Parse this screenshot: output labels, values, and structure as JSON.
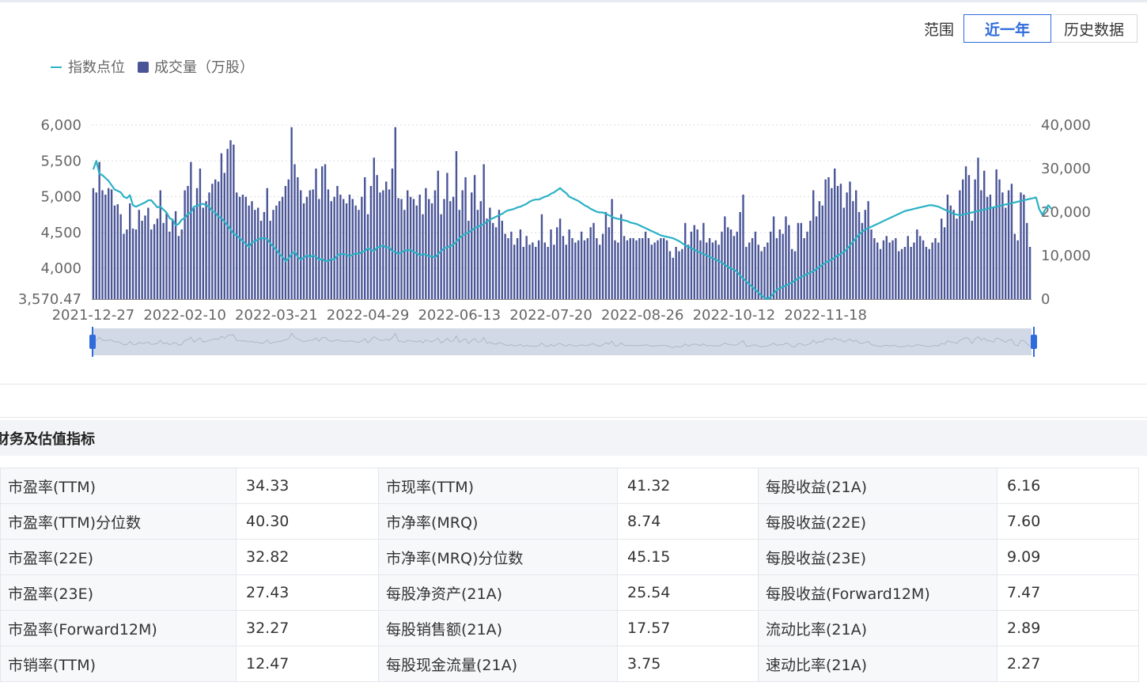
{
  "range": {
    "label": "范围",
    "options": [
      "近一年",
      "历史数据"
    ],
    "selected": "近一年"
  },
  "colors": {
    "line": "#2bb1c5",
    "bar": "#4a5597",
    "accent": "#2f6bdb",
    "grid": "#dddddd"
  },
  "chart_data": {
    "type": "bar",
    "grid": true,
    "legend_position": "top-left",
    "legend": [
      {
        "name": "指数点位",
        "kind": "line"
      },
      {
        "name": "成交量（万股）",
        "kind": "bar"
      }
    ],
    "y_left": {
      "ticks": [
        "6,000",
        "5,500",
        "5,000",
        "4,500",
        "4,000",
        "3,570.47"
      ],
      "range": [
        3570.47,
        6000
      ]
    },
    "y_right": {
      "ticks": [
        "40,000",
        "30,000",
        "20,000",
        "10,000",
        "0"
      ],
      "range": [
        0,
        40000
      ]
    },
    "x_tick_labels": [
      "2021-12-27",
      "2022-02-10",
      "2022-03-21",
      "2022-04-29",
      "2022-06-13",
      "2022-07-20",
      "2022-08-26",
      "2022-10-12",
      "2022-11-18"
    ],
    "x_tick_index": [
      0,
      30,
      60,
      90,
      120,
      150,
      180,
      210,
      240
    ],
    "series": [
      {
        "name": "成交量（万股）",
        "type": "bar",
        "axis": "right",
        "values": [
          25500,
          24500,
          31500,
          25000,
          24000,
          25500,
          25200,
          21500,
          21800,
          19500,
          15000,
          16000,
          22000,
          16200,
          16000,
          20500,
          18000,
          19200,
          21000,
          16000,
          17200,
          18500,
          25000,
          17500,
          19800,
          15500,
          18200,
          20200,
          14500,
          16000,
          25000,
          26000,
          31500,
          21000,
          25500,
          30000,
          21000,
          22500,
          24500,
          26500,
          27500,
          27000,
          33500,
          29000,
          34500,
          36500,
          35500,
          24500,
          23500,
          24000,
          23500,
          21500,
          22500,
          20500,
          21000,
          18000,
          20000,
          25500,
          18000,
          20500,
          21500,
          22500,
          23500,
          26000,
          27500,
          39500,
          31000,
          28000,
          25000,
          22000,
          23500,
          25000,
          25200,
          30000,
          23000,
          30500,
          31000,
          25200,
          22500,
          23500,
          26000,
          24000,
          23000,
          22000,
          24000,
          23000,
          21500,
          20500,
          23500,
          28000,
          19500,
          26000,
          32500,
          28500,
          24500,
          25000,
          27000,
          25200,
          30000,
          39500,
          23200,
          23000,
          20500,
          25000,
          23500,
          23000,
          21500,
          24000,
          19500,
          25500,
          23000,
          22000,
          25000,
          29500,
          19500,
          23000,
          29000,
          22500,
          23500,
          34000,
          20500,
          25000,
          28000,
          18000,
          24500,
          28500,
          20500,
          22500,
          31000,
          18500,
          21000,
          17500,
          16500,
          20500,
          18000,
          15000,
          14000,
          15500,
          12500,
          14000,
          16000,
          12000,
          14500,
          12500,
          13000,
          12000,
          13500,
          19500,
          13000,
          12000,
          16000,
          12500,
          16500,
          18500,
          14500,
          12500,
          16000,
          14000,
          13000,
          13500,
          15500,
          13500,
          14000,
          16500,
          17500,
          14000,
          12500,
          15000,
          20000,
          16500,
          23000,
          13500,
          13000,
          19500,
          14500,
          13500,
          14000,
          14000,
          13500,
          14000,
          14000,
          15500,
          14000,
          12500,
          13000,
          13500,
          14000,
          14000,
          13500,
          11000,
          9500,
          12000,
          11000,
          11500,
          17500,
          12500,
          15500,
          17000,
          16000,
          13500,
          17500,
          13000,
          14000,
          13000,
          13500,
          12500,
          15500,
          19000,
          16500,
          16000,
          14500,
          15500,
          20000,
          24000,
          12000,
          13000,
          14000,
          15500,
          12500,
          11000,
          12000,
          13000,
          15500,
          19000,
          14000,
          16000,
          15000,
          19000,
          17000,
          11500,
          11000,
          17500,
          17500,
          14000,
          15500,
          18000,
          25000,
          19000,
          22500,
          21500,
          27500,
          28000,
          25500,
          30000,
          26000,
          26500,
          21000,
          24500,
          27000,
          22500,
          25000,
          20000,
          17500,
          20500,
          22500,
          16000,
          14000,
          13000,
          11500,
          13500,
          14500,
          13000,
          13500,
          14000,
          11000,
          11500,
          12000,
          14500,
          12000,
          13000,
          16000,
          14500,
          13500,
          12000,
          11500,
          13000,
          14000,
          13000,
          18500,
          16500,
          24000,
          21500,
          20500,
          18500,
          25000,
          27500,
          30500,
          28500,
          18000,
          27500,
          32500,
          25000,
          29500,
          23500,
          24000,
          21000,
          29800,
          27500,
          24500,
          21000,
          25000,
          26500,
          15000,
          13500,
          24500,
          24000,
          17500,
          12000
        ]
      },
      {
        "name": "指数点位",
        "type": "line",
        "axis": "left",
        "values": [
          5380,
          5500,
          5320,
          5300,
          5260,
          5220,
          5160,
          5100,
          5080,
          5060,
          5000,
          4980,
          5020,
          4880,
          4860,
          4880,
          4900,
          4920,
          4950,
          4950,
          4900,
          4850,
          4860,
          4820,
          4780,
          4700,
          4680,
          4600,
          4620,
          4680,
          4700,
          4760,
          4780,
          4860,
          4870,
          4890,
          4900,
          4880,
          4860,
          4800,
          4780,
          4720,
          4700,
          4650,
          4600,
          4540,
          4480,
          4460,
          4420,
          4380,
          4340,
          4300,
          4360,
          4380,
          4400,
          4420,
          4420,
          4410,
          4350,
          4300,
          4260,
          4200,
          4160,
          4100,
          4140,
          4200,
          4230,
          4160,
          4120,
          4150,
          4180,
          4160,
          4180,
          4160,
          4120,
          4130,
          4100,
          4100,
          4130,
          4120,
          4180,
          4200,
          4200,
          4190,
          4170,
          4190,
          4210,
          4200,
          4230,
          4240,
          4280,
          4260,
          4240,
          4290,
          4300,
          4320,
          4290,
          4290,
          4240,
          4230,
          4200,
          4220,
          4250,
          4250,
          4260,
          4230,
          4210,
          4180,
          4200,
          4190,
          4170,
          4170,
          4150,
          4200,
          4240,
          4280,
          4290,
          4310,
          4330,
          4370,
          4420,
          4460,
          4480,
          4500,
          4530,
          4560,
          4580,
          4600,
          4620,
          4650,
          4680,
          4700,
          4720,
          4740,
          4760,
          4790,
          4810,
          4820,
          4830,
          4850,
          4860,
          4880,
          4900,
          4930,
          4950,
          4960,
          4960,
          4980,
          5000,
          5010,
          5040,
          5060,
          5090,
          5120,
          5080,
          5050,
          5000,
          4980,
          4960,
          4940,
          4910,
          4880,
          4860,
          4830,
          4810,
          4790,
          4780,
          4780,
          4760,
          4740,
          4720,
          4700,
          4690,
          4680,
          4670,
          4660,
          4640,
          4630,
          4620,
          4600,
          4580,
          4560,
          4540,
          4520,
          4500,
          4480,
          4460,
          4450,
          4440,
          4430,
          4420,
          4400,
          4380,
          4350,
          4320,
          4300,
          4280,
          4260,
          4240,
          4220,
          4200,
          4180,
          4160,
          4140,
          4120,
          4100,
          4080,
          4050,
          4020,
          4000,
          3980,
          3950,
          3900,
          3860,
          3820,
          3780,
          3740,
          3700,
          3660,
          3620,
          3590,
          3571,
          3600,
          3650,
          3700,
          3720,
          3740,
          3760,
          3780,
          3800,
          3830,
          3860,
          3880,
          3900,
          3920,
          3940,
          3960,
          3990,
          4020,
          4050,
          4080,
          4100,
          4120,
          4150,
          4180,
          4200,
          4230,
          4270,
          4320,
          4370,
          4420,
          4470,
          4510,
          4540,
          4560,
          4580,
          4600,
          4620,
          4640,
          4660,
          4680,
          4700,
          4720,
          4740,
          4760,
          4780,
          4800,
          4810,
          4820,
          4830,
          4840,
          4850,
          4860,
          4870,
          4880,
          4880,
          4870,
          4860,
          4840,
          4820,
          4800,
          4780,
          4760,
          4750,
          4740,
          4750,
          4760,
          4770,
          4780,
          4790,
          4800,
          4810,
          4820,
          4830,
          4840,
          4850,
          4860,
          4870,
          4880,
          4890,
          4900,
          4910,
          4920,
          4930,
          4940,
          4950,
          4960,
          4970,
          4980,
          4990,
          4830,
          4750,
          4820,
          4880,
          4830
        ]
      }
    ]
  },
  "section": {
    "title": "财务及估值指标"
  },
  "metrics": [
    [
      [
        "市盈率(TTM)",
        "34.33"
      ],
      [
        "市现率(TTM)",
        "41.32"
      ],
      [
        "每股收益(21A)",
        "6.16"
      ]
    ],
    [
      [
        "市盈率(TTM)分位数",
        "40.30"
      ],
      [
        "市净率(MRQ)",
        "8.74"
      ],
      [
        "每股收益(22E)",
        "7.60"
      ]
    ],
    [
      [
        "市盈率(22E)",
        "32.82"
      ],
      [
        "市净率(MRQ)分位数",
        "45.15"
      ],
      [
        "每股收益(23E)",
        "9.09"
      ]
    ],
    [
      [
        "市盈率(23E)",
        "27.43"
      ],
      [
        "每股净资产(21A)",
        "25.54"
      ],
      [
        "每股收益(Forward12M)",
        "7.47"
      ]
    ],
    [
      [
        "市盈率(Forward12M)",
        "32.27"
      ],
      [
        "每股销售额(21A)",
        "17.57"
      ],
      [
        "流动比率(21A)",
        "2.89"
      ]
    ],
    [
      [
        "市销率(TTM)",
        "12.47"
      ],
      [
        "每股现金流量(21A)",
        "3.75"
      ],
      [
        "速动比率(21A)",
        "2.27"
      ]
    ]
  ]
}
